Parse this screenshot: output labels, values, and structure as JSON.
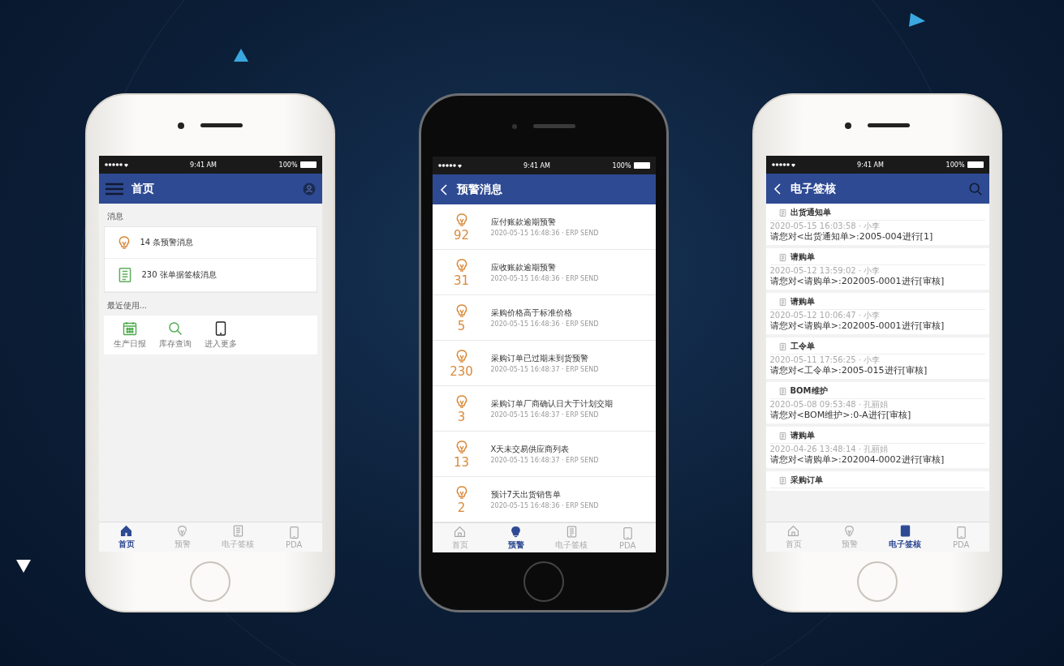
{
  "phones": [
    {
      "kind": "white",
      "status_bar": {
        "time": "9:41 AM",
        "battery": "100%"
      },
      "header": {
        "title": "首页"
      },
      "screen": {
        "kind": "home",
        "sections": [
          {
            "title": "消息",
            "items": [
              {
                "text": "14 条预警消息"
              },
              {
                "text": "230 张单据签核消息"
              }
            ]
          },
          {
            "title": "最近使用...",
            "shortcuts": [
              {
                "label": "生产日报"
              },
              {
                "label": "库存查询"
              },
              {
                "label": "进入更多"
              }
            ]
          }
        ]
      },
      "tabs": [
        {
          "label": "首页",
          "selected": true
        },
        {
          "label": "预警",
          "selected": false
        },
        {
          "label": "电子签核",
          "selected": false
        },
        {
          "label": "PDA",
          "selected": false
        }
      ]
    },
    {
      "kind": "black",
      "status_bar": {
        "time": "9:41 AM",
        "battery": "100%"
      },
      "header": {
        "title": "预警消息"
      },
      "screen": {
        "kind": "alerts",
        "rows": [
          {
            "count": "92",
            "title": "应付账款逾期预警",
            "meta": "2020-05-15 16:48:36 · ERP SEND"
          },
          {
            "count": "31",
            "title": "应收账款逾期预警",
            "meta": "2020-05-15 16:48:36 · ERP SEND"
          },
          {
            "count": "5",
            "title": "采购价格高于标准价格",
            "meta": "2020-05-15 16:48:36 · ERP SEND"
          },
          {
            "count": "230",
            "title": "采购订单已过期未到货预警",
            "meta": "2020-05-15 16:48:37 · ERP SEND"
          },
          {
            "count": "3",
            "title": "采购订单厂商确认日大于计划交期",
            "meta": "2020-05-15 16:48:37 · ERP SEND"
          },
          {
            "count": "13",
            "title": "X天未交易供应商列表",
            "meta": "2020-05-15 16:48:37 · ERP SEND"
          },
          {
            "count": "2",
            "title": "预计7天出货销售单",
            "meta": "2020-05-15 16:48:36 · ERP SEND"
          }
        ]
      },
      "tabs": [
        {
          "label": "首页",
          "selected": false
        },
        {
          "label": "预警",
          "selected": true
        },
        {
          "label": "电子签核",
          "selected": false
        },
        {
          "label": "PDA",
          "selected": false
        }
      ]
    },
    {
      "kind": "white",
      "status_bar": {
        "time": "9:41 AM",
        "battery": "100%"
      },
      "header": {
        "title": "电子签核"
      },
      "screen": {
        "kind": "approvals",
        "rows": [
          {
            "type": "出货通知单",
            "meta": "2020-05-15 16:03:58 · 小李",
            "text": "请您对<出货通知单>:2005-004进行[1]"
          },
          {
            "type": "请购单",
            "meta": "2020-05-12 13:59:02 · 小李",
            "text": "请您对<请购单>:202005-0001进行[审核]"
          },
          {
            "type": "请购单",
            "meta": "2020-05-12 10:06:47 · 小李",
            "text": "请您对<请购单>:202005-0001进行[审核]"
          },
          {
            "type": "工令单",
            "meta": "2020-05-11 17:56:25 · 小李",
            "text": "请您对<工令单>:2005-015进行[审核]"
          },
          {
            "type": "BOM维护",
            "meta": "2020-05-08 09:53:48 · 孔丽娟",
            "text": "请您对<BOM维护>:0-A进行[审核]"
          },
          {
            "type": "请购单",
            "meta": "2020-04-26 13:48:14 · 孔丽娟",
            "text": "请您对<请购单>:202004-0002进行[审核]"
          },
          {
            "type": "采购订单"
          }
        ]
      },
      "tabs": [
        {
          "label": "首页",
          "selected": false
        },
        {
          "label": "预警",
          "selected": false
        },
        {
          "label": "电子签核",
          "selected": true
        },
        {
          "label": "PDA",
          "selected": false
        }
      ]
    }
  ]
}
